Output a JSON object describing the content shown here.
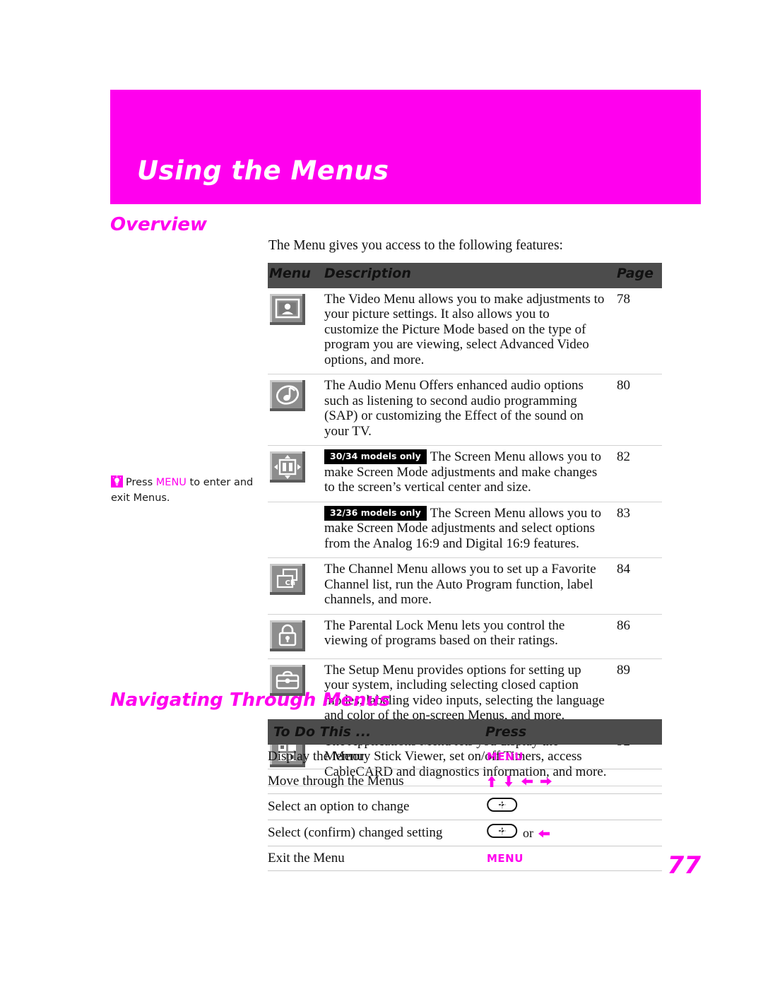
{
  "chapter": {
    "title": "Using the Menus",
    "banner_color": "#ff00ee"
  },
  "page_number": "77",
  "overview": {
    "heading": "Overview",
    "intro": "The Menu gives you access to the following features:",
    "table": {
      "columns": [
        "Menu",
        "Description",
        "Page"
      ],
      "rows": [
        {
          "icon": "video-menu-icon",
          "badge": "",
          "description": "The Video Menu allows you to make adjustments to your picture settings. It also allows you to customize the Picture Mode based on the type of program you are viewing, select Advanced Video options, and more.",
          "page": "78"
        },
        {
          "icon": "audio-menu-icon",
          "badge": "",
          "description": "The Audio Menu Offers enhanced audio options such as listening to second audio programming (SAP) or customizing the Effect of the sound on your TV.",
          "page": "80"
        },
        {
          "icon": "screen-menu-icon",
          "badge": "30/34 models only",
          "description": "The Screen Menu allows you to make Screen Mode adjustments and make changes to the screen’s vertical center and size.",
          "page": "82"
        },
        {
          "icon": "",
          "badge": "32/36 models only",
          "description": "The Screen Menu allows you to make Screen Mode adjustments and select options from the Analog 16:9 and Digital 16:9 features.",
          "page": "83"
        },
        {
          "icon": "channel-menu-icon",
          "badge": "",
          "description": "The Channel Menu allows you to set up a Favorite Channel list, run the Auto Program function, label channels, and more.",
          "page": "84"
        },
        {
          "icon": "parental-lock-menu-icon",
          "badge": "",
          "description": "The Parental Lock Menu lets you control the viewing of programs based on their ratings.",
          "page": "86"
        },
        {
          "icon": "setup-menu-icon",
          "badge": "",
          "description": "The Setup Menu provides options for  setting up your system, including selecting closed caption modes, labeling video inputs, selecting the language and color of the on-screen Menus, and more.",
          "page": "89"
        },
        {
          "icon": "applications-menu-icon",
          "badge": "",
          "description": "The Applications Menu lets you display the Memory Stick Viewer, set on/off Timers, access CableCARD and diagnostics information, and more.",
          "page": "92"
        }
      ]
    }
  },
  "tip": {
    "icon": "lightbulb-tip-icon",
    "text_before": "Press ",
    "keyword": "MENU",
    "text_after": " to enter and exit Menus."
  },
  "navigating": {
    "heading": "Navigating Through Menus",
    "table": {
      "columns": [
        "To Do This ...",
        "Press"
      ],
      "rows": [
        {
          "action": "Display the Menu",
          "press_type": "keyword",
          "press": "MENU"
        },
        {
          "action": "Move through the Menus",
          "press_type": "arrows",
          "press": "up down left right"
        },
        {
          "action": "Select an option to change",
          "press_type": "jog",
          "press": "center-jog-button"
        },
        {
          "action": "Select (confirm) changed setting",
          "press_type": "jog-or-arrow",
          "press": "center-jog-button or left-arrow",
          "or_label": "or"
        },
        {
          "action": "Exit the Menu",
          "press_type": "keyword",
          "press": "MENU"
        }
      ]
    }
  },
  "colors": {
    "accent": "#ff00ee",
    "table_header": "#4c4c4c",
    "badge_bg": "#000000",
    "icon_button": "#8a8a8a"
  }
}
